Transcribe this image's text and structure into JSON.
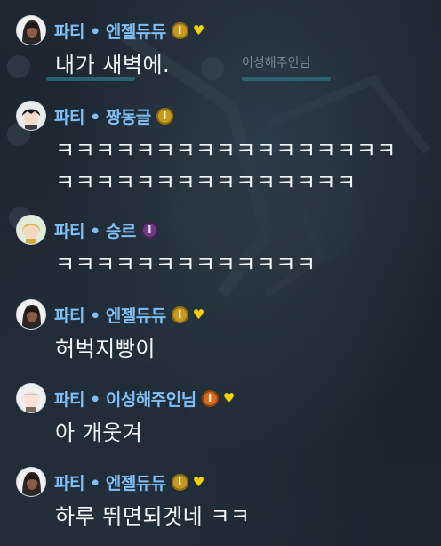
{
  "background": {
    "ghost_name": "이성해주인님"
  },
  "messages": [
    {
      "name": "파티 • 엔젤듀듀",
      "badge": "I",
      "badge_color": "gold",
      "heart": true,
      "avatar": "avatar-dark-hair",
      "lines": [
        "내가 새벽에."
      ]
    },
    {
      "name": "파티 • 짱동글",
      "badge": "I",
      "badge_color": "gold",
      "heart": false,
      "avatar": "avatar-black-hair",
      "lines": [
        "ㅋㅋㅋㅋㅋㅋㅋㅋㅋㅋㅋㅋㅋㅋㅋㅋㅋ",
        "ㅋㅋㅋㅋㅋㅋㅋㅋㅋㅋㅋㅋㅋㅋㅋ"
      ]
    },
    {
      "name": "파티 • 승르",
      "badge": "I",
      "badge_color": "purple",
      "heart": false,
      "avatar": "avatar-blonde",
      "lines": [
        "ㅋㅋㅋㅋㅋㅋㅋㅋㅋㅋㅋㅋㅋ"
      ]
    },
    {
      "name": "파티 • 엔젤듀듀",
      "badge": "I",
      "badge_color": "gold",
      "heart": true,
      "avatar": "avatar-dark-hair",
      "lines": [
        "허벅지빵이"
      ]
    },
    {
      "name": "파티 • 이성해주인님",
      "badge": "I",
      "badge_color": "orange",
      "heart": true,
      "avatar": "avatar-white-hair",
      "lines": [
        "아 개웃겨"
      ]
    },
    {
      "name": "파티 • 엔젤듀듀",
      "badge": "I",
      "badge_color": "gold",
      "heart": true,
      "avatar": "avatar-dark-hair",
      "lines": [
        "하루 뛰면되겟네 ㅋㅋ"
      ]
    }
  ],
  "colors": {
    "name": "#7fbff5",
    "text": "#f4f6f8",
    "heart": "#f0d200"
  }
}
